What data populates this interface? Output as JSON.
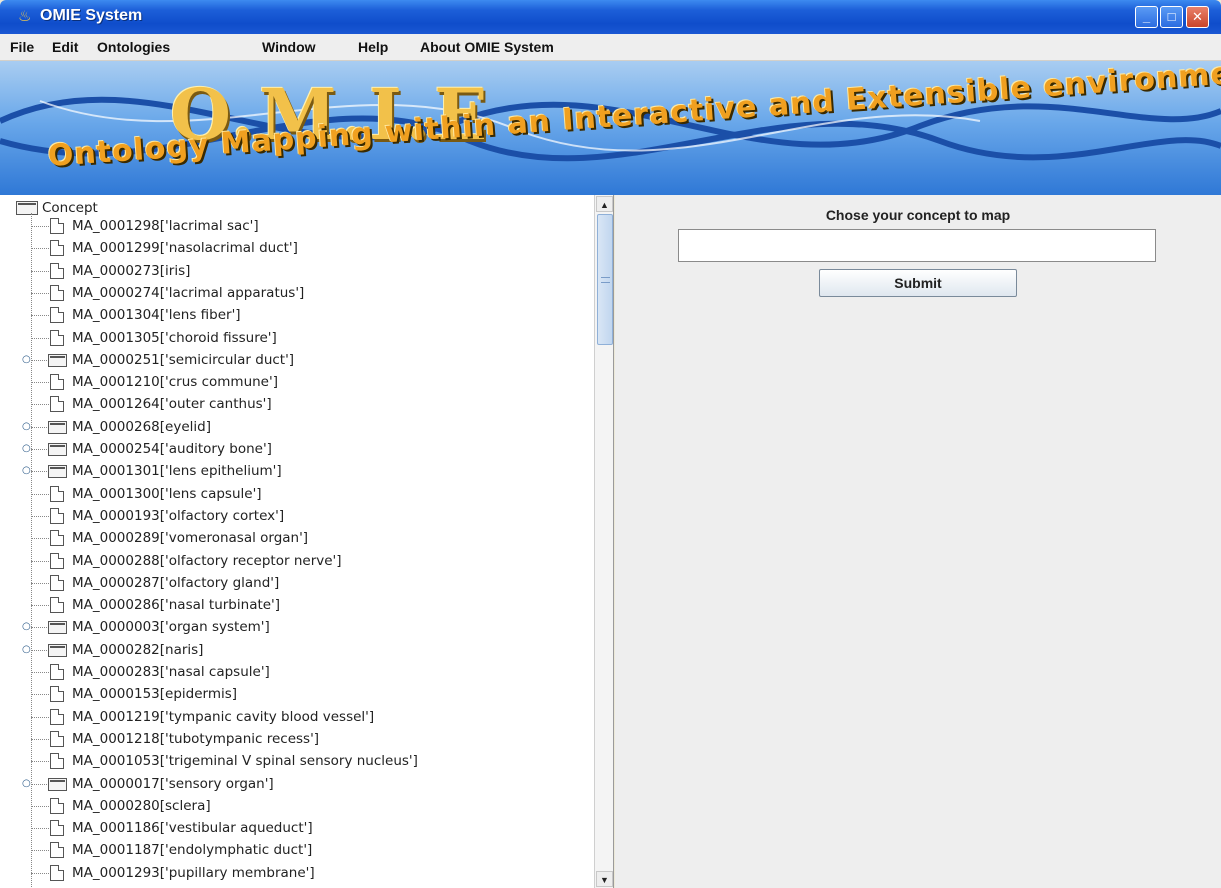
{
  "window": {
    "title": "OMIE System",
    "title_icon": "java-cup-icon"
  },
  "menu": [
    "File",
    "Edit",
    "Ontologies",
    "Window",
    "Help",
    "About OMIE System"
  ],
  "banner": {
    "logo": "O.M.I.E",
    "tagline": "Ontology Mapping within an Interactive and Extensible environment"
  },
  "tree": {
    "root": "Concept",
    "nodes": [
      {
        "label": "MA_0001298['lacrimal sac']",
        "folder": false
      },
      {
        "label": "MA_0001299['nasolacrimal duct']",
        "folder": false
      },
      {
        "label": "MA_0000273[iris]",
        "folder": false
      },
      {
        "label": "MA_0000274['lacrimal apparatus']",
        "folder": false
      },
      {
        "label": "MA_0001304['lens fiber']",
        "folder": false
      },
      {
        "label": "MA_0001305['choroid fissure']",
        "folder": false
      },
      {
        "label": "MA_0000251['semicircular duct']",
        "folder": true
      },
      {
        "label": "MA_0001210['crus commune']",
        "folder": false
      },
      {
        "label": "MA_0001264['outer canthus']",
        "folder": false
      },
      {
        "label": "MA_0000268[eyelid]",
        "folder": true
      },
      {
        "label": "MA_0000254['auditory bone']",
        "folder": true
      },
      {
        "label": "MA_0001301['lens epithelium']",
        "folder": true
      },
      {
        "label": "MA_0001300['lens capsule']",
        "folder": false
      },
      {
        "label": "MA_0000193['olfactory cortex']",
        "folder": false
      },
      {
        "label": "MA_0000289['vomeronasal organ']",
        "folder": false
      },
      {
        "label": "MA_0000288['olfactory receptor nerve']",
        "folder": false
      },
      {
        "label": "MA_0000287['olfactory gland']",
        "folder": false
      },
      {
        "label": "MA_0000286['nasal turbinate']",
        "folder": false
      },
      {
        "label": "MA_0000003['organ system']",
        "folder": true
      },
      {
        "label": "MA_0000282[naris]",
        "folder": true
      },
      {
        "label": "MA_0000283['nasal capsule']",
        "folder": false
      },
      {
        "label": "MA_0000153[epidermis]",
        "folder": false
      },
      {
        "label": "MA_0001219['tympanic cavity blood vessel']",
        "folder": false
      },
      {
        "label": "MA_0001218['tubotympanic recess']",
        "folder": false
      },
      {
        "label": "MA_0001053['trigeminal V spinal sensory nucleus']",
        "folder": false
      },
      {
        "label": "MA_0000017['sensory organ']",
        "folder": true
      },
      {
        "label": "MA_0000280[sclera]",
        "folder": false
      },
      {
        "label": "MA_0001186['vestibular aqueduct']",
        "folder": false
      },
      {
        "label": "MA_0001187['endolymphatic duct']",
        "folder": false
      },
      {
        "label": "MA_0001293['pupillary membrane']",
        "folder": false
      }
    ]
  },
  "mapping": {
    "prompt": "Chose your concept to map",
    "input_value": "",
    "submit_label": "Submit"
  },
  "colors": {
    "titlebar": "#0f4dcb",
    "banner": "#6aa8ea",
    "panel": "#eeeeee"
  }
}
